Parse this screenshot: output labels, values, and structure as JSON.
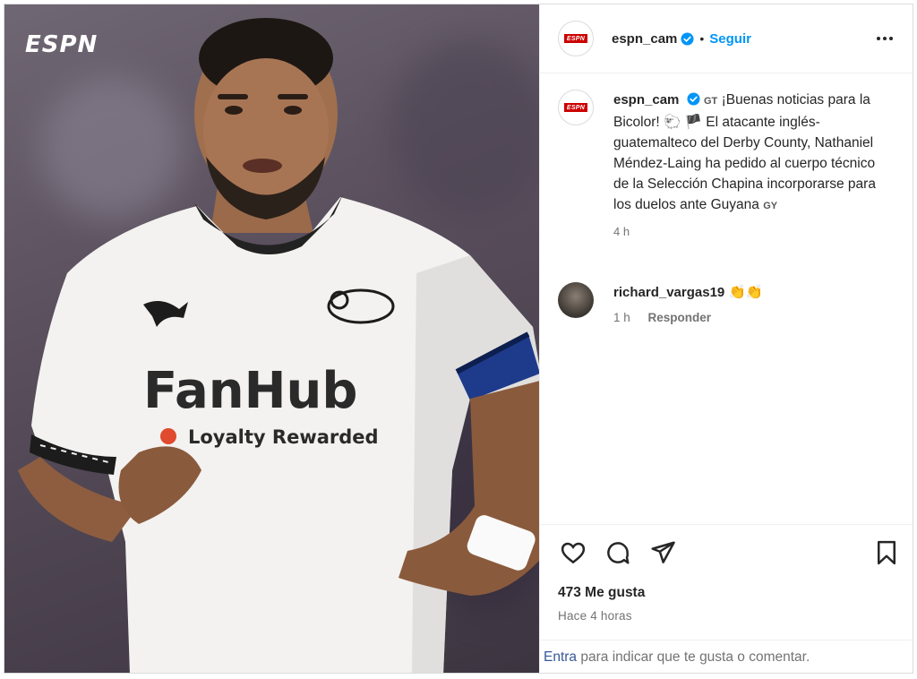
{
  "media": {
    "watermark": "ESPN",
    "shirt_sponsor": "FanHub",
    "shirt_slogan": "Loyalty Rewarded"
  },
  "header": {
    "avatar_logo": "ESPN",
    "username": "espn_cam",
    "separator": "•",
    "follow_label": "Seguir",
    "more_icon": "more-horizontal-icon"
  },
  "caption": {
    "username": "espn_cam",
    "flag_code": "GT",
    "text_1": "¡Buenas noticias para la Bicolor!",
    "emoji_1": "🐑",
    "emoji_2": "🏴",
    "text_2": "El atacante inglés-guatemalteco del Derby County, Nathaniel Méndez-Laing ha pedido al cuerpo técnico de la Selección Chapina incorporarse para los duelos ante Guyana",
    "flag_code_2": "GY",
    "time": "4 h"
  },
  "comment": {
    "username": "richard_vargas19",
    "emoji": "👏👏",
    "time": "1 h",
    "reply_label": "Responder"
  },
  "actions": {
    "like_icon": "heart-icon",
    "comment_icon": "comment-icon",
    "share_icon": "send-icon",
    "save_icon": "bookmark-icon"
  },
  "likes": "473 Me gusta",
  "post_time": "Hace 4 horas",
  "login_bar": {
    "link": "Entra",
    "text": " para indicar que te gusta o comentar."
  },
  "colors": {
    "follow": "#0095f6",
    "verified": "#0095f6",
    "espn_red": "#cc0000"
  }
}
